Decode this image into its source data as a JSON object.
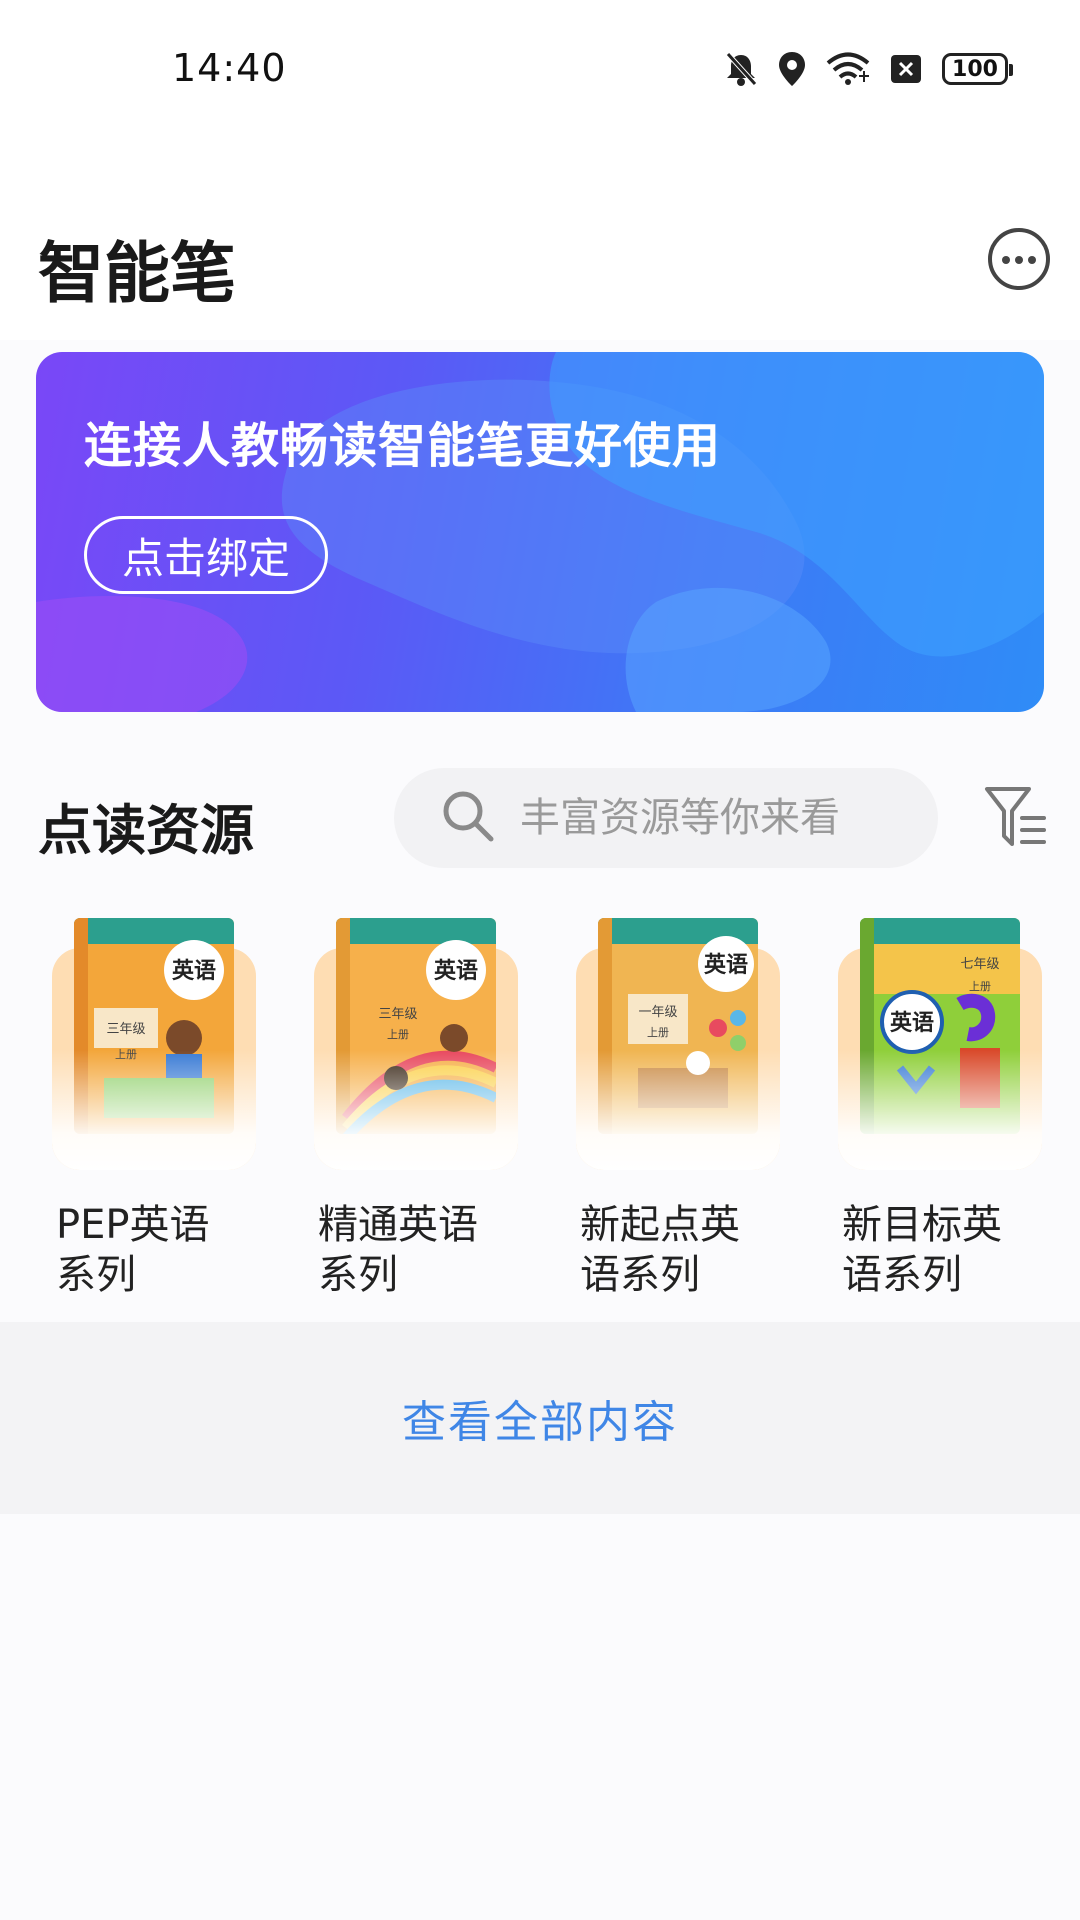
{
  "status_bar": {
    "time": "14:40",
    "battery": "100",
    "icons": [
      "mute-bell-icon",
      "location-icon",
      "wifi-icon",
      "no-sim-icon",
      "battery-icon"
    ]
  },
  "app_bar": {
    "title": "智能笔",
    "more_icon": "more-circle-icon"
  },
  "banner": {
    "title": "连接人教畅读智能笔更好使用",
    "button_label": "点击绑定",
    "colors": [
      "#7a47f7",
      "#3e78f6",
      "#2f8cf7"
    ]
  },
  "resources": {
    "title": "点读资源",
    "search_placeholder": "丰富资源等你来看",
    "filter_icon": "filter-icon",
    "books": [
      {
        "label": "PEP英语系列",
        "cover_text": "英语",
        "grade": "三年级",
        "term": "上册",
        "cover_color": "#f3a63a"
      },
      {
        "label": "精通英语系列",
        "cover_text": "英语",
        "grade": "三年级",
        "term": "上册",
        "cover_color": "#f6b04b"
      },
      {
        "label": "新起点英语系列",
        "cover_text": "英语",
        "grade": "一年级",
        "term": "上册",
        "cover_color": "#f0b552"
      },
      {
        "label": "新目标英语系列",
        "cover_text": "英语",
        "grade": "七年级",
        "term": "上册",
        "cover_color": "#f4c44a"
      }
    ]
  },
  "footer": {
    "view_all_label": "查看全部内容"
  },
  "theme": {
    "accent": "#3f86e6"
  }
}
